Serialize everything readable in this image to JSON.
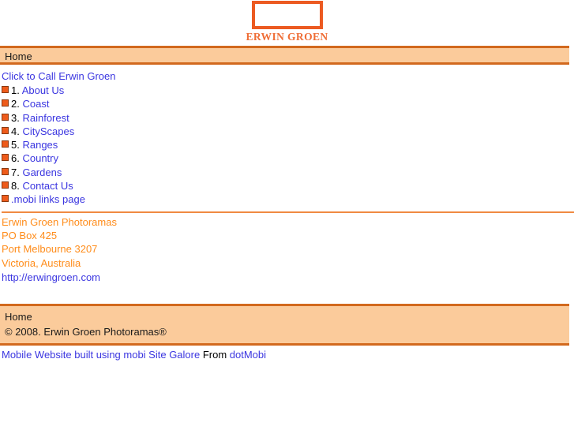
{
  "logo": {
    "mark": "orange-rectangle-outline",
    "wordmark": "ERWIN GROEN"
  },
  "colors": {
    "brand_orange": "#ec5a21",
    "bar_fill": "#fbcb9b",
    "bar_border": "#d2691e",
    "link_blue": "#3b36e0",
    "address_orange": "#ff8c1a",
    "bullet_orange": "#ee5b1b"
  },
  "header_bar": {
    "label": "Home"
  },
  "main": {
    "call_link": "Click to Call Erwin Groen",
    "items": [
      {
        "index": "1.",
        "label": "About Us"
      },
      {
        "index": "2.",
        "label": "Coast"
      },
      {
        "index": "3.",
        "label": "Rainforest"
      },
      {
        "index": "4.",
        "label": "CityScapes"
      },
      {
        "index": "5.",
        "label": "Ranges"
      },
      {
        "index": "6.",
        "label": "Country"
      },
      {
        "index": "7.",
        "label": "Gardens"
      },
      {
        "index": "8.",
        "label": "Contact Us"
      },
      {
        "index": "",
        "label": ".mobi links page"
      }
    ],
    "address": [
      "Erwin Groen Photoramas",
      "PO Box 425",
      "Port Melbourne 3207",
      "Victoria, Australia"
    ],
    "site_url": "http://erwingroen.com"
  },
  "footer_bar": {
    "home_label": "Home",
    "copyright": "© 2008. Erwin Groen Photoramas®"
  },
  "credit": {
    "builder_link": "Mobile Website built using mobi Site Galore",
    "middle_text": " From ",
    "provider_link": "dotMobi"
  }
}
